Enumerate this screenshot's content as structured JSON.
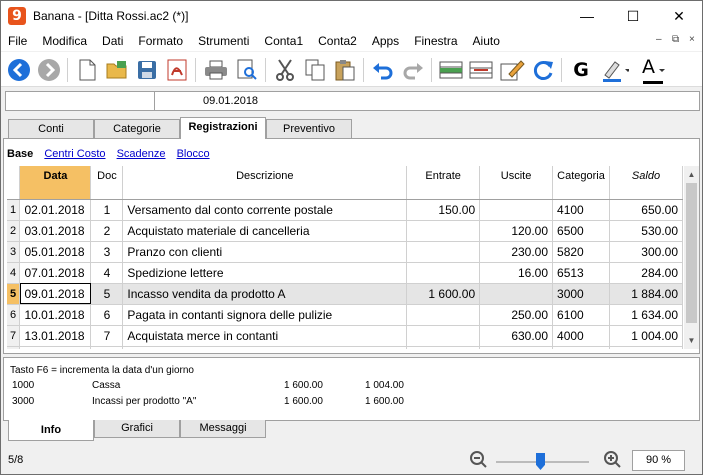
{
  "window": {
    "app_name": "Banana",
    "title": "Banana - [Ditta Rossi.ac2 (*)]",
    "app_icon_glyph": "9",
    "minimize": "—",
    "maximize": "☐",
    "close": "✕"
  },
  "menu": [
    "File",
    "Modifica",
    "Dati",
    "Formato",
    "Strumenti",
    "Conta1",
    "Conta2",
    "Apps",
    "Finestra",
    "Aiuto"
  ],
  "mdi_controls": {
    "minimize": "–",
    "restore": "⧉",
    "close": "×"
  },
  "toolbar": {
    "font_bold": "G",
    "font_color": "A"
  },
  "cell_bar": {
    "cell_ref": "",
    "cell_value": "09.01.2018"
  },
  "tabs": [
    "Conti",
    "Categorie",
    "Registrazioni",
    "Preventivo"
  ],
  "active_tab": "Registrazioni",
  "views": {
    "base": "Base",
    "links": [
      "Centri Costo",
      "Scadenze",
      "Blocco"
    ]
  },
  "columns": [
    "Data",
    "Doc",
    "Descrizione",
    "Entrate",
    "Uscite",
    "Categoria",
    "Saldo"
  ],
  "rows": [
    {
      "n": "1",
      "data": "02.01.2018",
      "doc": "1",
      "desc": "Versamento dal conto corrente postale",
      "entrate": "150.00",
      "uscite": "",
      "cat": "4100",
      "saldo": "650.00"
    },
    {
      "n": "2",
      "data": "03.01.2018",
      "doc": "2",
      "desc": "Acquistato materiale di cancelleria",
      "entrate": "",
      "uscite": "120.00",
      "cat": "6500",
      "saldo": "530.00"
    },
    {
      "n": "3",
      "data": "05.01.2018",
      "doc": "3",
      "desc": "Pranzo con clienti",
      "entrate": "",
      "uscite": "230.00",
      "cat": "5820",
      "saldo": "300.00"
    },
    {
      "n": "4",
      "data": "07.01.2018",
      "doc": "4",
      "desc": "Spedizione lettere",
      "entrate": "",
      "uscite": "16.00",
      "cat": "6513",
      "saldo": "284.00"
    },
    {
      "n": "5",
      "data": "09.01.2018",
      "doc": "5",
      "desc": "Incasso vendita da prodotto A",
      "entrate": "1 600.00",
      "uscite": "",
      "cat": "3000",
      "saldo": "1 884.00"
    },
    {
      "n": "6",
      "data": "10.01.2018",
      "doc": "6",
      "desc": "Pagata in contanti signora delle pulizie",
      "entrate": "",
      "uscite": "250.00",
      "cat": "6100",
      "saldo": "1 634.00"
    },
    {
      "n": "7",
      "data": "13.01.2018",
      "doc": "7",
      "desc": "Acquistata merce in contanti",
      "entrate": "",
      "uscite": "630.00",
      "cat": "4000",
      "saldo": "1 004.00"
    },
    {
      "n": "",
      "data": "",
      "doc": "",
      "desc": "",
      "entrate": "",
      "uscite": "",
      "cat": "",
      "saldo": ""
    }
  ],
  "current_row": "5",
  "info": {
    "message": "Tasto F6 = incrementa la data d'un giorno",
    "lines": [
      {
        "account": "1000",
        "desc": "Cassa",
        "v1": "1 600.00",
        "v2": "1 004.00"
      },
      {
        "account": "3000",
        "desc": "Incassi per prodotto \"A\"",
        "v1": "1 600.00",
        "v2": "1 600.00"
      }
    ]
  },
  "bottom_tabs": [
    "Info",
    "Grafici",
    "Messaggi"
  ],
  "status": {
    "position": "5/8",
    "zoom_value": "90",
    "zoom_unit": "%",
    "zoom_level": 0.45
  },
  "colors": {
    "accent": "#f5c064",
    "selected_col_header": "#f5c064",
    "zoom_thumb": "#1e6fd9",
    "link": "#0000cc"
  }
}
